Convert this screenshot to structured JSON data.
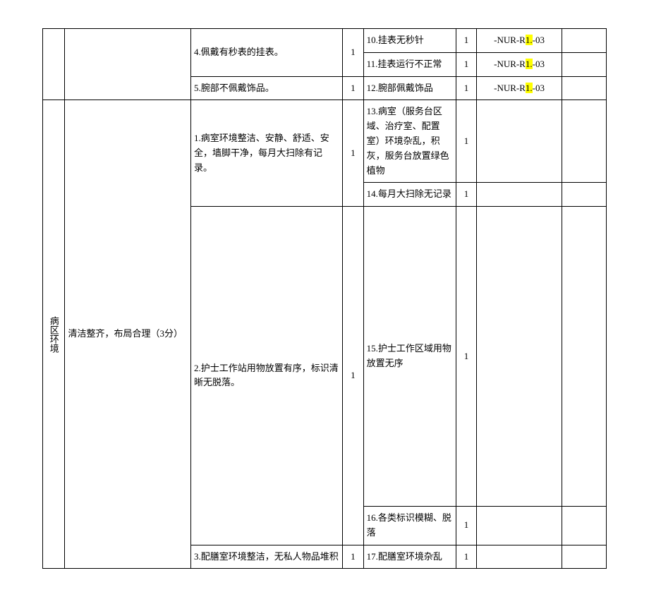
{
  "rows": {
    "r10": {
      "issue": "10.挂表无秒针",
      "s2": "1",
      "code_prefix": "-NUR-R",
      "code_hl": "1.",
      "code_suffix": "-03"
    },
    "r11": {
      "item": "4.佩戴有秒表的挂表。",
      "s1": "1",
      "issue": "11.挂表运行不正常",
      "s2": "1",
      "code_prefix": "-NUR-R",
      "code_hl": "1.",
      "code_suffix": "-03"
    },
    "r12": {
      "item": "5.腕部不佩戴饰品。",
      "s1": "1",
      "issue": "12.腕部佩戴饰品",
      "s2": "1",
      "code_prefix": "-NUR-R",
      "code_hl": "1.",
      "code_suffix": "-03"
    },
    "r13": {
      "issue": "13.病室（服务台区域、治疗室、配置室）环境杂乱，积灰，服务台放置绿色植物",
      "s2": "1"
    },
    "r14": {
      "item": "1.病室环境整洁、安静、舒适、安全，墙脚干净，每月大扫除有记录。",
      "s1": "1",
      "issue": "14.每月大扫除无记录",
      "s2": "1"
    },
    "r15": {
      "issue": "15.护士工作区域用物放置无序",
      "s2": "1"
    },
    "r16": {
      "item": "2.护士工作站用物放置有序，标识清晰无脱落。",
      "s1": "1",
      "issue": "16.各类标识模糊、脱落",
      "s2": "1"
    },
    "r17": {
      "item": "3.配膳室环境整洁，无私人物品堆积",
      "s1": "1",
      "issue": "17.配膳室环境杂乱",
      "s2": "1"
    }
  },
  "section": {
    "category": "病区环境",
    "group": "清洁整齐，布局合理（3分）"
  }
}
